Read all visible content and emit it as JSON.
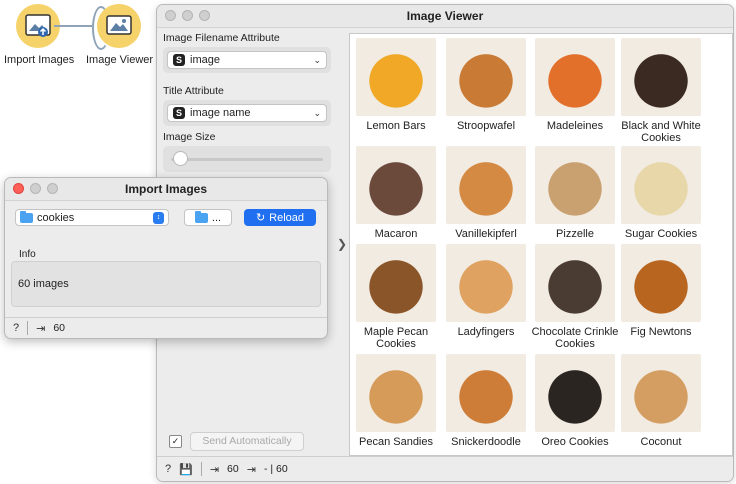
{
  "canvas": {
    "nodes": [
      {
        "label": "Import Images",
        "icon": "import-images-icon"
      },
      {
        "label": "Image Viewer",
        "icon": "image-viewer-icon"
      }
    ]
  },
  "viewer": {
    "title": "Image Viewer",
    "filename_attr": {
      "label": "Image Filename Attribute",
      "value": "image"
    },
    "title_attr": {
      "label": "Title Attribute",
      "value": "image name"
    },
    "image_size": {
      "label": "Image Size",
      "level": 0.05
    },
    "send_auto": {
      "label": "Send Automatically",
      "checked": true
    },
    "images": [
      {
        "caption": "Lemon Bars",
        "color": "#f0a826"
      },
      {
        "caption": "Stroopwafel",
        "color": "#c97a35"
      },
      {
        "caption": "Madeleines",
        "color": "#e3702a"
      },
      {
        "caption": "Black and White Cookies",
        "color": "#3a2a22"
      },
      {
        "caption": "Macaron",
        "color": "#6b4a3c"
      },
      {
        "caption": "Vanillekipferl",
        "color": "#d48a42"
      },
      {
        "caption": "Pizzelle",
        "color": "#c9a070"
      },
      {
        "caption": "Sugar Cookies",
        "color": "#e8d7a8"
      },
      {
        "caption": "Maple Pecan Cookies",
        "color": "#8a5528"
      },
      {
        "caption": "Ladyfingers",
        "color": "#e0a260"
      },
      {
        "caption": "Chocolate Crinkle Cookies",
        "color": "#4a3b33"
      },
      {
        "caption": "Fig Newtons",
        "color": "#b8651f"
      },
      {
        "caption": "Pecan Sandies",
        "color": "#d69b58"
      },
      {
        "caption": "Snickerdoodle",
        "color": "#cd7d38"
      },
      {
        "caption": "Oreo Cookies",
        "color": "#2b2522"
      },
      {
        "caption": "Coconut",
        "color": "#d49e63"
      }
    ],
    "status": {
      "input_count": "60",
      "output_count": "- | 60"
    }
  },
  "import": {
    "title": "Import Images",
    "folder": "cookies",
    "browse_label": "...",
    "reload_label": "Reload",
    "info_label": "Info",
    "info_text": "60 images",
    "status_count": "60"
  }
}
